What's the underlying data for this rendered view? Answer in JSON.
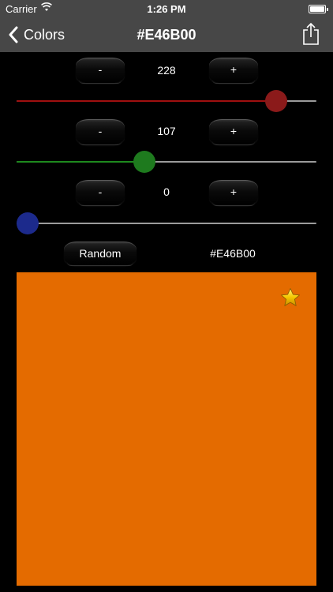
{
  "status_bar": {
    "carrier": "Carrier",
    "time": "1:26 PM"
  },
  "nav": {
    "back_label": "Colors",
    "title": "#E46B00",
    "share_icon": "share-icon"
  },
  "controls": {
    "red": {
      "minus": "-",
      "plus": "+",
      "value": "228",
      "level": 0.894,
      "color": "#8B1A1A",
      "fill": "#A01010"
    },
    "green": {
      "minus": "-",
      "plus": "+",
      "value": "107",
      "level": 0.42,
      "color": "#1E7A1E",
      "fill": "#1E8A1E"
    },
    "blue": {
      "minus": "-",
      "plus": "+",
      "value": "0",
      "level": 0.0,
      "color": "#1C2A8C",
      "fill": "#1C2A8C"
    }
  },
  "random_label": "Random",
  "hex": "#E46B00",
  "swatch": {
    "color": "#E46B00",
    "favorite_icon": "star-icon"
  }
}
